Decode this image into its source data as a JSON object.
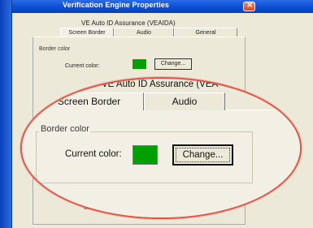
{
  "window": {
    "title": "Verification Engine Properties",
    "close_glyph": "×"
  },
  "dialog": {
    "heading": "VE Auto ID Assurance (VEAIDA)",
    "tabs": [
      {
        "label": "Screen Border"
      },
      {
        "label": "Audio"
      },
      {
        "label": "General"
      }
    ],
    "group_label": "Border color",
    "current_label": "Current color:",
    "change_button": "Change...",
    "partial_text": "bln"
  },
  "magnified": {
    "heading": "VE Auto ID Assurance (VEA",
    "tabs": [
      {
        "label": "Screen Border"
      },
      {
        "label": "Audio"
      }
    ],
    "group_label": "Border color",
    "current_label": "Current color:",
    "change_button": "Change..."
  },
  "colors": {
    "current_color": "#00a000",
    "highlight_ellipse": "#e2564a",
    "title_bar": "#0a4fd4"
  }
}
